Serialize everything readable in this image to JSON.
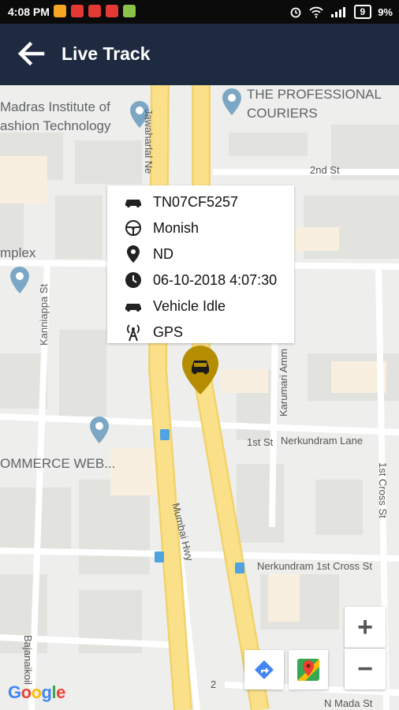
{
  "status_bar": {
    "time": "4:08 PM",
    "battery": "9",
    "battery_pct": "9%",
    "notification_colors": [
      "#f6a623",
      "#e53935",
      "#e53935",
      "#e53935",
      "#8bc34a"
    ]
  },
  "appbar": {
    "title": "Live Track",
    "background": "#1e2a40"
  },
  "map": {
    "labels": {
      "madras_1": "Madras Institute of",
      "madras_2": "ashion Technology",
      "couriers_1": "THE PROFESSIONAL",
      "couriers_2": "COURIERS",
      "jawaharlal": "Jawaharlal Ne",
      "second_st": "2nd St",
      "mplex": "mplex",
      "kanniappa": "Kanniappa St",
      "karumari": "Karumari Amm",
      "first_st": "1st St",
      "nerkundram_lane": "Nerkundram Lane",
      "first_cross": "1st Cross St",
      "ommerce": "OMMERCE WEB...",
      "mumbai": "Mumbai Hwy",
      "nerkundram_cross": "Nerkundram 1st Cross St",
      "bajanai": "Bajanaikoil",
      "n_mada": "N Mada St",
      "road_no": "2"
    },
    "google_logo": "Google"
  },
  "vehicle_info": {
    "number": "TN07CF5257",
    "driver": "Monish",
    "location": "ND",
    "datetime": "06-10-2018 4:07:30",
    "status": "Vehicle Idle",
    "source": "GPS"
  },
  "controls": {
    "zoom_in": "+",
    "zoom_out": "−"
  },
  "colors": {
    "accent": "#1e2a40",
    "marker": "#b58d00",
    "road_major": "#fbe08a"
  }
}
